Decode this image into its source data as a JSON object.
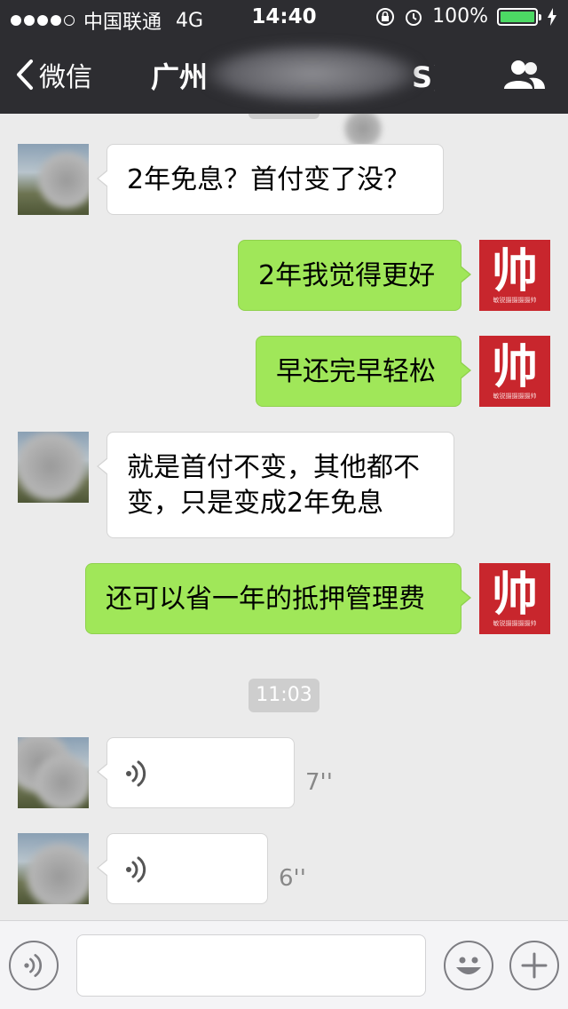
{
  "status_bar": {
    "carrier": "中国联通",
    "network": "4G",
    "time": "14:40",
    "battery": "100%"
  },
  "nav": {
    "back_label": "微信",
    "title": "广州",
    "title_suffix": "S)"
  },
  "messages": [
    {
      "side": "in",
      "text": "2年免息？首付变了没？"
    },
    {
      "side": "out",
      "text": "2年我觉得更好"
    },
    {
      "side": "out",
      "text": "早还完早轻松"
    },
    {
      "side": "in",
      "text": "就是首付不变，其他都不变，只是变成2年免息"
    },
    {
      "side": "out",
      "text": "还可以省一年的抵押管理费"
    }
  ],
  "timestamp": "11:03",
  "voice_messages": [
    {
      "duration": "7''"
    },
    {
      "duration": "6''"
    }
  ],
  "avatar_text": {
    "big": "帅",
    "small": "敏锐摄摄摄摄帅"
  },
  "input": {
    "placeholder": ""
  },
  "colors": {
    "navbar_bg": "#2d2d31",
    "chat_bg": "#ebebeb",
    "outgoing_bubble": "#a0e759",
    "incoming_bubble": "#ffffff",
    "avatar_red": "#c8262d"
  },
  "icons": {
    "back": "chevron-left-icon",
    "group": "people-icon",
    "voice": "voice-icon",
    "emoji": "emoji-icon",
    "add": "plus-icon"
  }
}
